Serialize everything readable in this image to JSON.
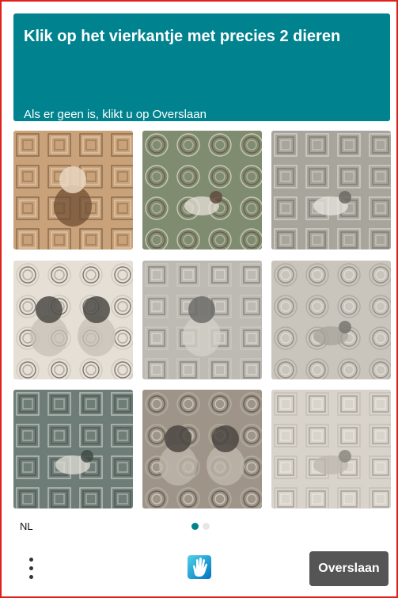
{
  "header": {
    "title": "Klik op het vierkantje met precies 2 dieren",
    "subtitle": "Als er geen is, klikt u op Overslaan"
  },
  "tiles": [
    {
      "subject": "puppy"
    },
    {
      "subject": "bird"
    },
    {
      "subject": "birds"
    },
    {
      "subject": "two puppies"
    },
    {
      "subject": "puppy"
    },
    {
      "subject": "bird"
    },
    {
      "subject": "bird"
    },
    {
      "subject": "two puppies"
    },
    {
      "subject": "bird"
    }
  ],
  "footer": {
    "language": "NL",
    "skip_label": "Overslaan",
    "page_indicator": {
      "current": 1,
      "total": 2
    }
  },
  "colors": {
    "accent": "#00838f",
    "border": "#e0201c",
    "button": "#555555"
  }
}
